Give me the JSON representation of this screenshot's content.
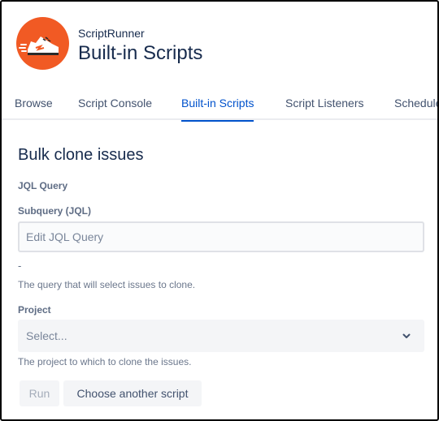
{
  "header": {
    "app_name": "ScriptRunner",
    "page_title": "Built-in Scripts",
    "logo_icon": "sneaker-icon",
    "logo_color": "#f15a24"
  },
  "tabs": [
    {
      "label": "Browse",
      "active": false
    },
    {
      "label": "Script Console",
      "active": false
    },
    {
      "label": "Built-in Scripts",
      "active": true
    },
    {
      "label": "Script Listeners",
      "active": false
    },
    {
      "label": "Schedule",
      "active": false
    }
  ],
  "form": {
    "title": "Bulk clone issues",
    "jql_label": "JQL Query",
    "subquery_label": "Subquery (JQL)",
    "subquery_placeholder": "Edit JQL Query",
    "subquery_value": "",
    "subquery_dash": "-",
    "subquery_help": "The query that will select issues to clone.",
    "project_label": "Project",
    "project_placeholder": "Select...",
    "project_help": "The project to which to clone the issues.",
    "run_label": "Run",
    "choose_label": "Choose another script"
  },
  "colors": {
    "accent": "#0052cc",
    "brand": "#f15a24"
  }
}
